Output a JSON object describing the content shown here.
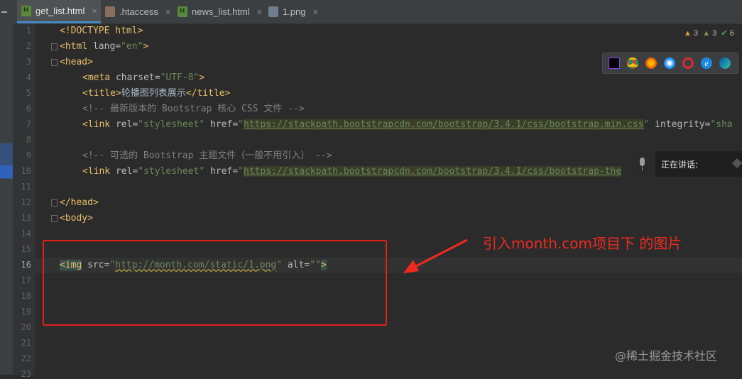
{
  "tabs": [
    {
      "label": "get_list.html",
      "icon": "html-file-icon",
      "active": true
    },
    {
      "label": ".htaccess",
      "icon": "htaccess-file-icon",
      "active": false
    },
    {
      "label": "news_list.html",
      "icon": "html-file-icon",
      "active": false
    },
    {
      "label": "1.png",
      "icon": "png-file-icon",
      "active": false
    }
  ],
  "line_numbers": [
    "1",
    "2",
    "3",
    "4",
    "5",
    "6",
    "7",
    "8",
    "9",
    "10",
    "11",
    "12",
    "13",
    "14",
    "15",
    "16",
    "17",
    "18",
    "19",
    "20",
    "21",
    "22",
    "23"
  ],
  "current_line": "16",
  "code": {
    "l1": "<!DOCTYPE html>",
    "l2_open": "<html ",
    "l2_attr": "lang=",
    "l2_val": "\"en\"",
    "l2_close": ">",
    "l3": "<head>",
    "l4_open": "<meta ",
    "l4_attr": "charset=",
    "l4_val": "\"UTF-8\"",
    "l4_close": ">",
    "l5_open": "<title>",
    "l5_text": "轮播图列表展示",
    "l5_close": "</title>",
    "l6": "<!-- 最新版本的 Bootstrap 核心 CSS 文件 -->",
    "l7_open": "<link ",
    "l7_attr1": "rel=",
    "l7_val1": "\"stylesheet\"",
    "l7_attr2": " href=",
    "l7_q1": "\"",
    "l7_url": "https://stackpath.bootstrapcdn.com/bootstrap/3.4.1/css/bootstrap.min.css",
    "l7_q2": "\"",
    "l7_attr3": " integrity=",
    "l7_val3": "\"sha",
    "l9": "<!-- 可选的 Bootstrap 主题文件（一般不用引入） -->",
    "l10_open": "<link ",
    "l10_attr1": "rel=",
    "l10_val1": "\"stylesheet\"",
    "l10_attr2": " href=",
    "l10_q1": "\"",
    "l10_url": "https://stackpath.bootstrapcdn.com/bootstrap/3.4.1/css/bootstrap-the",
    "l12": "</head>",
    "l13": "<body>",
    "l16_open": "<img",
    "l16_attr1": " src=",
    "l16_q1": "\"",
    "l16_url": "http://month.com/static/1.png",
    "l16_q2": "\"",
    "l16_attr2": " alt=",
    "l16_val2": "\"\"",
    "l16_close": ">"
  },
  "inspections": {
    "warnings": "3",
    "weak_warnings": "3",
    "ok": "6"
  },
  "browser_icons": [
    "phpstorm-icon",
    "chrome-icon",
    "firefox-icon",
    "safari-icon",
    "opera-icon",
    "ie-icon",
    "edge-icon"
  ],
  "speech_widget": {
    "label": "正在讲话:"
  },
  "annotation": {
    "text": "引入month.com项目下 的图片",
    "color": "#f02a1f"
  },
  "watermark": "@稀土掘金技术社区",
  "colors": {
    "tag": "#e8bf6a",
    "string": "#6a8759",
    "comment": "#808080",
    "background": "#2b2b2b"
  }
}
